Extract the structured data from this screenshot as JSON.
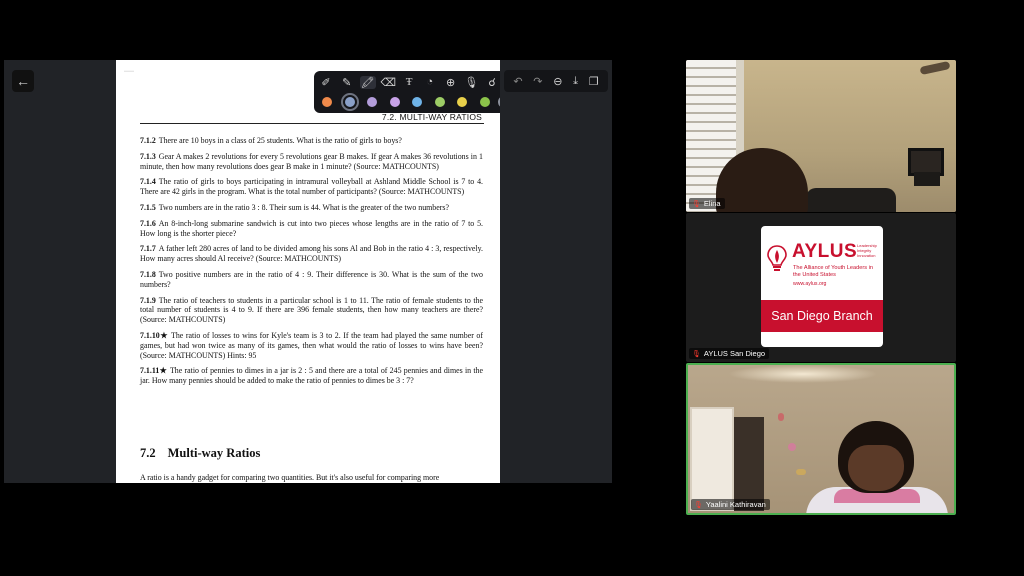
{
  "toolbar": {
    "back_icon": "arrow-left-icon",
    "annotation_tools": [
      "pen-icon",
      "pencil-icon",
      "highlighter-icon",
      "eraser-icon",
      "text-icon",
      "shape-icon",
      "stamp-icon",
      "mic-icon",
      "spotlight-icon",
      "more-icon"
    ],
    "colors": [
      "#f08a4b",
      "#8aa0c8",
      "#b39ddb",
      "#c8a2e8",
      "#6fb3e8",
      "#9ccc65",
      "#e8d04a",
      "#8bc34a"
    ],
    "right_tools": [
      "undo-icon",
      "redo-icon",
      "minus-icon",
      "save-icon",
      "copy-icon"
    ]
  },
  "document": {
    "section_header": "7.2.  MULTI-WAY RATIOS",
    "problems": [
      {
        "num": "7.1.2",
        "text": "There are 10 boys in a class of 25 students. What is the ratio of girls to boys?"
      },
      {
        "num": "7.1.3",
        "text": "Gear A makes 2 revolutions for every 5 revolutions gear B makes. If gear A makes 36 revolutions in 1 minute, then how many revolutions does gear B make in 1 minute? (Source: MATHCOUNTS)"
      },
      {
        "num": "7.1.4",
        "text": "The ratio of girls to boys participating in intramural volleyball at Ashland Middle School is 7 to 4. There are 42 girls in the program. What is the total number of participants? (Source: MATHCOUNTS)"
      },
      {
        "num": "7.1.5",
        "text": "Two numbers are in the ratio 3 : 8. Their sum is 44. What is the greater of the two numbers?"
      },
      {
        "num": "7.1.6",
        "text": "An 8-inch-long submarine sandwich is cut into two pieces whose lengths are in the ratio of 7 to 5. How long is the shorter piece?"
      },
      {
        "num": "7.1.7",
        "text": "A father left 280 acres of land to be divided among his sons Al and Bob in the ratio 4 : 3, respectively. How many acres should Al receive? (Source: MATHCOUNTS)"
      },
      {
        "num": "7.1.8",
        "text": "Two positive numbers are in the ratio of 4 : 9. Their difference is 30. What is the sum of the two numbers?"
      },
      {
        "num": "7.1.9",
        "text": "The ratio of teachers to students in a particular school is 1 to 11. The ratio of female students to the total number of students is 4 to 9. If there are 396 female students, then how many teachers are there? (Source: MATHCOUNTS)"
      },
      {
        "num": "7.1.10★",
        "text": "The ratio of losses to wins for Kyle's team is 3 to 2. If the team had played the same number of games, but had won twice as many of its games, then what would the ratio of losses to wins have been? (Source: MATHCOUNTS) Hints: 95"
      },
      {
        "num": "7.1.11★",
        "text": "The ratio of pennies to dimes in a jar is 2 : 5 and there are a total of 245 pennies and dimes in the jar. How many pennies should be added to make the ratio of pennies to dimes be 3 : 7?"
      }
    ],
    "section_number": "7.2",
    "section_title": "Multi-way Ratios",
    "section_intro": "A ratio is a handy gadget for comparing two quantities. But it's also useful for comparing more"
  },
  "participants": {
    "elina": {
      "name": "Elina"
    },
    "aylus": {
      "name": "AYLUS San Diego",
      "logo_big": "AYLUS",
      "logo_tags": [
        "Leadership",
        "Integrity",
        "Innovation"
      ],
      "logo_full": "The Alliance of Youth Leaders in the United States",
      "logo_url": "www.aylus.org",
      "logo_branch": "San Diego Branch"
    },
    "yaalini": {
      "name": "Yaalini Kathiravan"
    }
  },
  "colors": {
    "active_speaker": "#4caf50",
    "aylus_red": "#c8102e",
    "mic_muted": "#ff3b30"
  }
}
